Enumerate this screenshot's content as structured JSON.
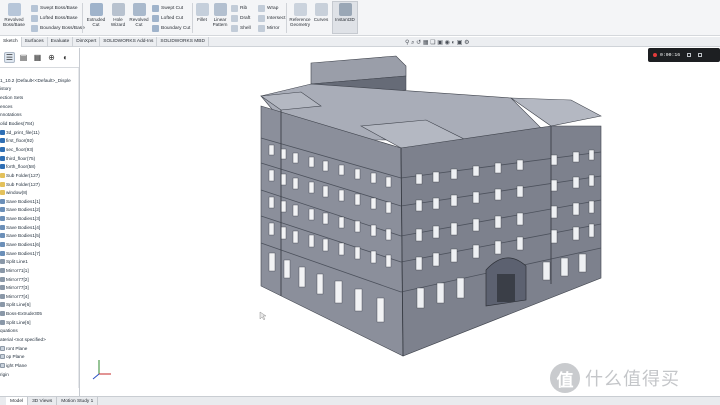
{
  "ribbon": {
    "buttons": [
      {
        "id": "revolved-boss",
        "label": "Revolved Boss/Base",
        "color": "#b7c6d9"
      },
      {
        "id": "extruded-cut",
        "label": "Extruded Cut",
        "color": "#9fb3cb"
      },
      {
        "id": "hole-wizard",
        "label": "Hole Wizard",
        "color": "#b8c2cf"
      },
      {
        "id": "revolved-cut",
        "label": "Revolved Cut",
        "color": "#a9b9cc"
      },
      {
        "id": "fillet",
        "label": "Fillet",
        "color": "#c5cfdb"
      },
      {
        "id": "linear-pattern",
        "label": "Linear Pattern",
        "color": "#b3c0d0"
      },
      {
        "id": "reference-geometry",
        "label": "Reference Geometry",
        "color": "#cbd3dd"
      },
      {
        "id": "curves",
        "label": "Curves",
        "color": "#c8d0da"
      },
      {
        "id": "instant3d",
        "label": "Instant3D",
        "color": "#9aa7b6"
      }
    ],
    "small": [
      {
        "id": "swept-boss",
        "label": "Swept Boss/Base"
      },
      {
        "id": "lofted-boss",
        "label": "Lofted Boss/Base"
      },
      {
        "id": "boundary-boss",
        "label": "Boundary Boss/Base"
      },
      {
        "id": "swept-cut",
        "label": "Swept Cut"
      },
      {
        "id": "lofted-cut",
        "label": "Lofted Cut"
      },
      {
        "id": "boundary-cut",
        "label": "Boundary Cut"
      },
      {
        "id": "rib",
        "label": "Rib"
      },
      {
        "id": "draft",
        "label": "Draft"
      },
      {
        "id": "shell",
        "label": "Shell"
      },
      {
        "id": "wrap",
        "label": "Wrap"
      },
      {
        "id": "intersect",
        "label": "Intersect"
      },
      {
        "id": "mirror",
        "label": "Mirror"
      }
    ]
  },
  "tabs": [
    "Sketch",
    "Surfaces",
    "Evaluate",
    "DimXpert",
    "SOLIDWORKS Add-Ins",
    "SOLIDWORKS MBD"
  ],
  "feature_tree": [
    {
      "label": "1_10.2  (Default<<Default>_Disple",
      "icon": "none"
    },
    {
      "label": "istory",
      "icon": "none"
    },
    {
      "label": "ection Sets",
      "icon": "none"
    },
    {
      "label": "ences",
      "icon": "none"
    },
    {
      "label": "nnotations",
      "icon": "none"
    },
    {
      "label": "olid Bodies(784)",
      "icon": "none"
    },
    {
      "label": "3d_print_file(11)",
      "icon": "body"
    },
    {
      "label": "first_floor(92)",
      "icon": "body"
    },
    {
      "label": "sec_floor(93)",
      "icon": "body"
    },
    {
      "label": "third_floor(75)",
      "icon": "body"
    },
    {
      "label": "forth_floor(58)",
      "icon": "body"
    },
    {
      "label": "Sub Folder(127)",
      "icon": "fold"
    },
    {
      "label": "Sub Folder(127)",
      "icon": "fold"
    },
    {
      "label": "window(8)",
      "icon": "fold"
    },
    {
      "label": "Save Bodies1[1]",
      "icon": "save"
    },
    {
      "label": "Save Bodies1[2]",
      "icon": "save"
    },
    {
      "label": "Save Bodies1[3]",
      "icon": "save"
    },
    {
      "label": "Save Bodies1[4]",
      "icon": "save"
    },
    {
      "label": "Save Bodies1[5]",
      "icon": "save"
    },
    {
      "label": "Save Bodies1[6]",
      "icon": "save"
    },
    {
      "label": "Save Bodies1[7]",
      "icon": "save"
    },
    {
      "label": "Split Line1",
      "icon": "feat"
    },
    {
      "label": "Mirror71[1]",
      "icon": "feat"
    },
    {
      "label": "Mirror77[2]",
      "icon": "feat"
    },
    {
      "label": "Mirror77[3]",
      "icon": "feat"
    },
    {
      "label": "Mirror77[4]",
      "icon": "feat"
    },
    {
      "label": "Split Line[6]",
      "icon": "feat"
    },
    {
      "label": "Boss-Extrude305",
      "icon": "feat"
    },
    {
      "label": "Split Line[6]",
      "icon": "feat"
    },
    {
      "label": "quations",
      "icon": "none"
    },
    {
      "label": "aterial <not specified>",
      "icon": "none"
    },
    {
      "label": "ront Plane",
      "icon": "plane"
    },
    {
      "label": "op Plane",
      "icon": "plane"
    },
    {
      "label": "ight Plane",
      "icon": "plane"
    },
    {
      "label": "rigin",
      "icon": "none"
    }
  ],
  "recorder": {
    "time": "0:00:16"
  },
  "bottom_tabs": [
    "Model",
    "3D Views",
    "Motion Study 1"
  ],
  "watermark": {
    "badge": "值",
    "text": "什么值得买"
  },
  "colors": {
    "building": "#8b8f9b",
    "building_dark": "#575c68",
    "roof": "#a9adb8",
    "accent": "#2f6fb5"
  }
}
